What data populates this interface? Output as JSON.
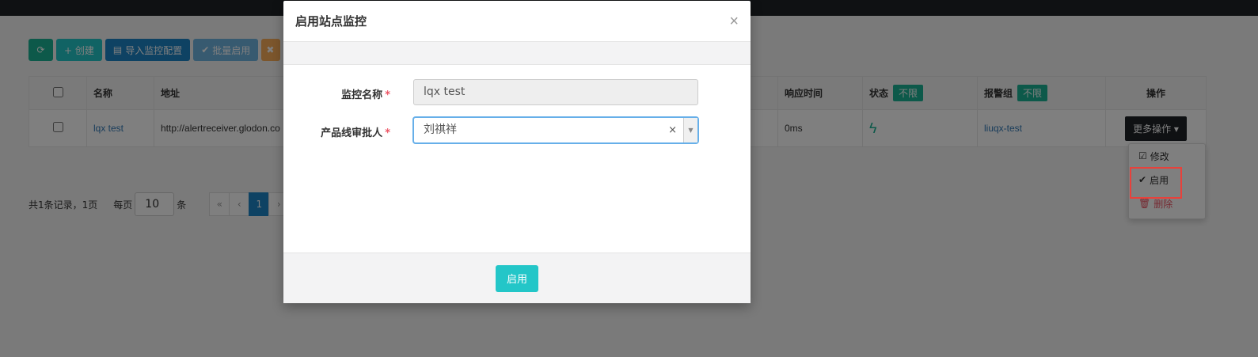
{
  "toolbar": {
    "refresh_icon": "refresh-icon",
    "create_label": "+ 创建",
    "import_label": "导入监控配置",
    "batch_enable_label": "批量启用",
    "batch_delete_icon": "close-icon"
  },
  "table": {
    "headers": [
      "名称",
      "地址",
      "响应时间",
      "状态",
      "报警组",
      "操作"
    ],
    "status_filter": "不限",
    "alarm_filter": "不限",
    "rows": [
      {
        "name": "lqx test",
        "address": "http://alertreceiver.glodon.co",
        "response_time": "0ms",
        "status_icon": "bolt-icon",
        "alarm_group": "liuqx-test",
        "action": "更多操作"
      }
    ]
  },
  "dropdown": {
    "items": [
      {
        "label": "修改",
        "icon": "check-square-icon"
      },
      {
        "label": "启用",
        "icon": "check-icon"
      },
      {
        "label": "删除",
        "icon": "trash-icon"
      }
    ]
  },
  "pager": {
    "summary": "共1条记录，1页",
    "per_page_label": "每页",
    "page_size": "10",
    "unit": "条",
    "first": "«",
    "prev": "‹",
    "current": "1",
    "next": "›"
  },
  "modal": {
    "title": "启用站点监控",
    "close": "×",
    "fields": {
      "monitor_name_label": "监控名称",
      "monitor_name_value": "lqx test",
      "approver_label": "产品线审批人",
      "approver_value": "刘祺祥"
    },
    "required_mark": "*",
    "clear": "×",
    "submit_label": "启用"
  },
  "colors": {
    "primary": "#23c6c8",
    "green": "#1ab394",
    "blue": "#1c84c6",
    "danger": "#ed5565"
  }
}
